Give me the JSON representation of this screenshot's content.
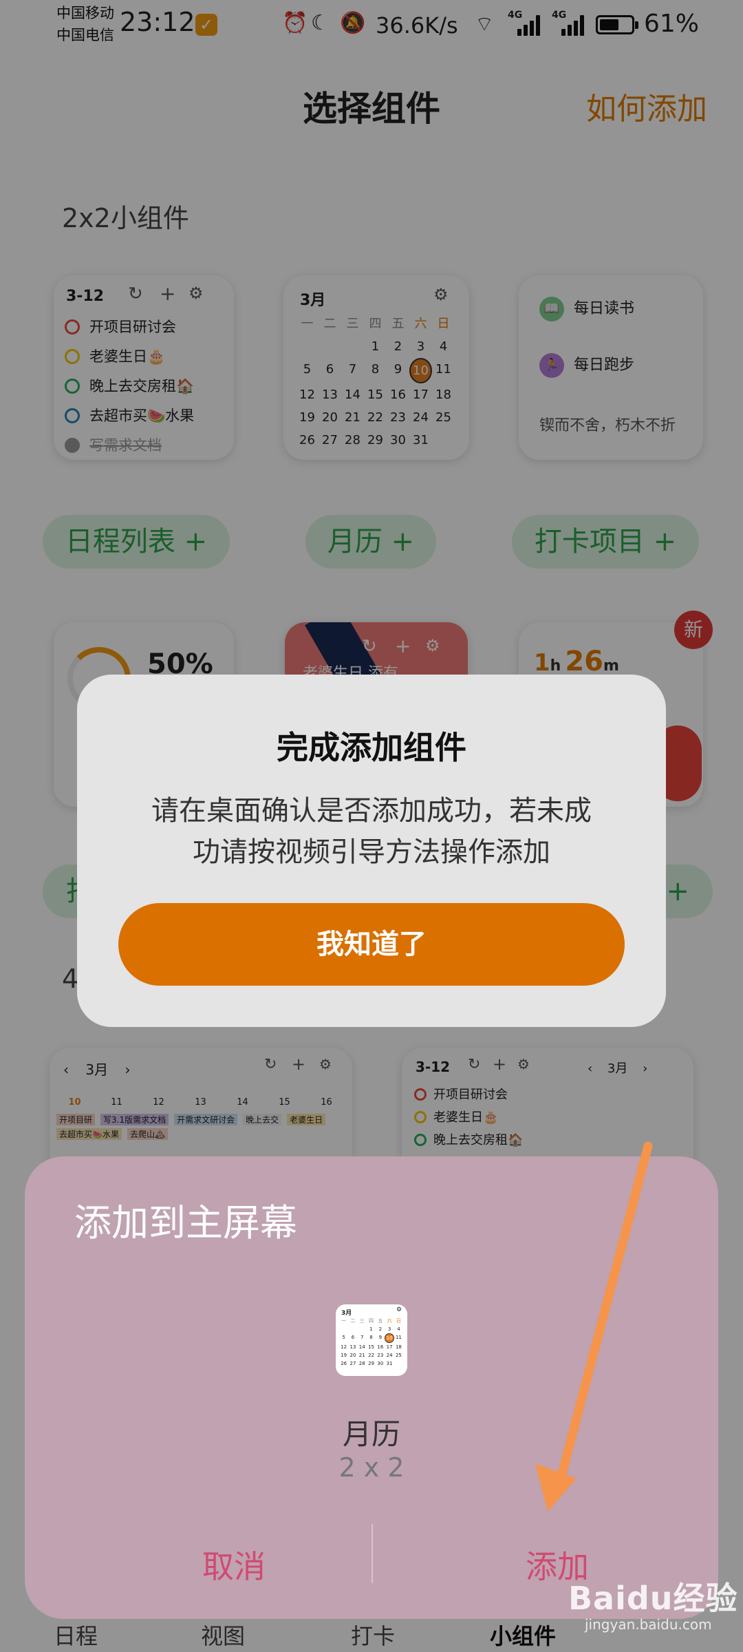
{
  "status_bar": {
    "carrier1": "中国移动",
    "carrier2": "中国电信",
    "time": "23:12",
    "speed": "36.6K/s",
    "net1": "4G",
    "net2": "4G",
    "battery_text": "61%",
    "battery_level": 0.61
  },
  "header": {
    "title": "选择组件",
    "link": "如何添加"
  },
  "sections": {
    "s2x2": "2x2小组件",
    "s4x2": "4"
  },
  "schedule_widget": {
    "date": "3-12",
    "items": [
      {
        "text": "开项目研讨会",
        "color": "#e74c3c"
      },
      {
        "text": "老婆生日🎂",
        "color": "#f1c40f"
      },
      {
        "text": "晚上去交房租🏠",
        "color": "#27ae60"
      },
      {
        "text": "去超市买🍉水果",
        "color": "#2980b9"
      },
      {
        "text": "写需求文档",
        "color": "#999999",
        "done": true
      }
    ]
  },
  "calendar_widget": {
    "month": "3月",
    "weekdays": [
      "一",
      "二",
      "三",
      "四",
      "五",
      "六",
      "日"
    ],
    "weeks": [
      [
        "",
        "",
        "",
        "1",
        "2",
        "3",
        "4"
      ],
      [
        "5",
        "6",
        "7",
        "8",
        "9",
        "10",
        "11"
      ],
      [
        "12",
        "13",
        "14",
        "15",
        "16",
        "17",
        "18"
      ],
      [
        "19",
        "20",
        "21",
        "22",
        "23",
        "24",
        "25"
      ],
      [
        "26",
        "27",
        "28",
        "29",
        "30",
        "31",
        ""
      ]
    ],
    "today": "10"
  },
  "checkin_widget": {
    "items": [
      "每日读书",
      "每日跑步"
    ],
    "quote": "锲而不舍，朽木不折"
  },
  "chips": [
    "日程列表 +",
    "月历 +",
    "打卡项目 +"
  ],
  "row2": {
    "percent": "50%",
    "red_text": "老婆生日 添有",
    "timer_h": "1",
    "timer_h_unit": "h",
    "timer_m": "26",
    "timer_m_unit": "m",
    "new_badge": "新",
    "chip_left": "打",
    "chip_right": "+"
  },
  "row3": {
    "left_month": "3月",
    "left_days": [
      "10",
      "11",
      "12",
      "13",
      "14",
      "15",
      "16"
    ],
    "left_events": [
      "开项目研",
      "写3.1版需求文档",
      "开需求文研讨会",
      "晚上去交",
      "老婆生日",
      "去超市买🍉水果",
      "去爬山🏔"
    ],
    "right_date": "3-12",
    "right_items": [
      "开项目研讨会",
      "老婆生日🎂",
      "晚上去交房租🏠"
    ],
    "right_month": "3月"
  },
  "dialog": {
    "title": "完成添加组件",
    "message_line1": "请在桌面确认是否添加成功，若未成",
    "message_line2": "功请按视频引导方法操作添加",
    "button": "我知道了"
  },
  "sheet": {
    "title": "添加到主屏幕",
    "widget_name": "月历",
    "widget_size": "2 x 2",
    "cancel": "取消",
    "add": "添加"
  },
  "bottom_nav": [
    "日程",
    "视图",
    "打卡",
    "小组件"
  ],
  "watermark": {
    "brand": "Baidu经验",
    "url": "jingyan.baidu.com"
  },
  "colors": {
    "accent_orange": "#d97000",
    "green": "#2ea34b",
    "pink": "#d04a72",
    "sheet_bg": "#c0a2b0",
    "arrow": "#f5944a"
  }
}
